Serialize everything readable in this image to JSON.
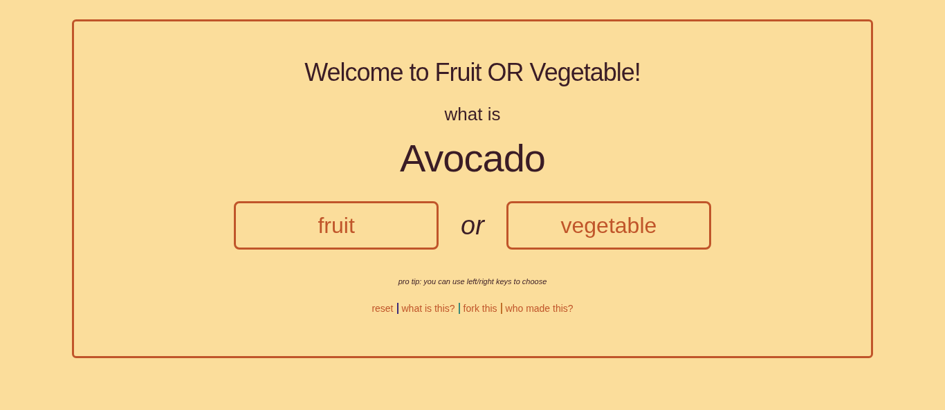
{
  "title": "Welcome to Fruit OR Vegetable!",
  "prompt": "what is",
  "item": "Avocado",
  "choices": [
    {
      "label": "fruit"
    },
    {
      "label": "vegetable"
    }
  ],
  "connector": "or",
  "tip": "pro tip: you can use left/right keys to choose",
  "footer": [
    {
      "kind": "link",
      "text": "reset"
    },
    {
      "kind": "separator",
      "color": "#3b2a7a"
    },
    {
      "kind": "link",
      "text": "what is this?"
    },
    {
      "kind": "separator",
      "color": "#3b8a7a"
    },
    {
      "kind": "link",
      "text": "fork this"
    },
    {
      "kind": "separator",
      "color": "#c0702a"
    },
    {
      "kind": "link",
      "text": "who made this?"
    }
  ]
}
